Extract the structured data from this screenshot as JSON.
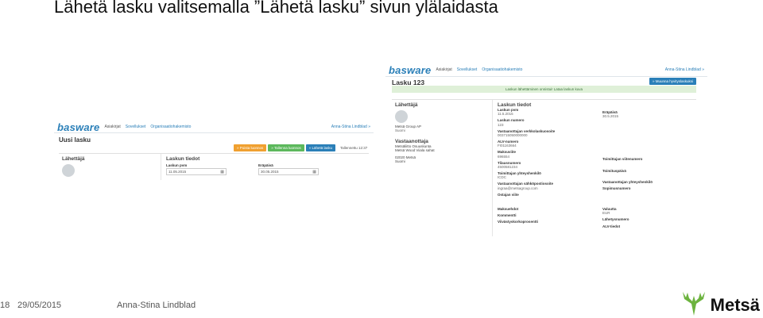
{
  "slide": {
    "title": "Lähetä lasku valitsemalla ”Lähetä lasku” sivun ylälaidasta",
    "page_number": "18",
    "date": "29/05/2015",
    "author": "Anna-Stina Lindblad",
    "logo_text": "Metsä",
    "logo_color": "#6cb33e"
  },
  "screenshot_small": {
    "logo": "basware",
    "nav": [
      "Asiakirjat",
      "Sovellukset",
      "Organisaatiohakemisto"
    ],
    "user": "Anna-Stina Lindblad »",
    "page_title": "Uusi lasku",
    "actions": [
      "» Poista luonnos",
      "» Tallenna luonnos",
      "» Lähetä lasku"
    ],
    "saved_text": "Tallennettu 12:37",
    "sender_heading": "Lähettäjä",
    "invoice_heading": "Laskun tiedot",
    "invoice_date_label": "Laskun pvm",
    "invoice_date_value": "11.05.2015",
    "due_date_label": "Eräpäivä",
    "due_date_value": "30.05.2015"
  },
  "screenshot_large": {
    "logo": "basware",
    "nav": [
      "Asiakirjat",
      "Sovellukset",
      "Organisaatiohakemisto"
    ],
    "user": "Anna-Stina Lindblad »",
    "new_button": "» Muunna hyvityslaskuksi",
    "page_title": "Lasku 123",
    "notice": "Laskun lähettäminen onnistui! Lataa laskun kuva",
    "sender_heading": "Lähettäjä",
    "sender_name": "Metsä Group AP",
    "sender_country": "Suomi",
    "recipient_heading": "Vastaanottaja",
    "recipient_lines": [
      "Metsäliitto Osuuskunta",
      "Metsä Wood Viiala sahat",
      "02020 Metsä",
      "Suomi"
    ],
    "invoice_heading": "Laskun tiedot",
    "mid_fields": [
      {
        "label": "Laskun pvm",
        "value": "11.5.2015"
      },
      {
        "label": "Laskun numero",
        "value": "123"
      },
      {
        "label": "Vastaanottajan verkkolaskuosoite",
        "value": "003715050000000"
      },
      {
        "label": "ALV-numero",
        "value": "FI01163664"
      },
      {
        "label": "Maksuviite",
        "value": "696554"
      },
      {
        "label": "Tilausnumero",
        "value": "4500581234"
      },
      {
        "label": "Toimittajan yhteyshenkilö",
        "value": "ICDC"
      },
      {
        "label": "Vastaanottajan sähköpostiosoite",
        "value": "ingraa@metsagroup.com"
      },
      {
        "label": "Ostajan viite",
        "value": ""
      },
      {
        "label": "Maksuehdot",
        "value": ""
      },
      {
        "label": "Kommentti",
        "value": ""
      },
      {
        "label": "Viivästyskorkoprosentti",
        "value": ""
      }
    ],
    "right_fields": [
      {
        "label": "Eräpäivä",
        "value": "30.5.2015"
      },
      {
        "label": "Toimittajan viitenumero",
        "value": ""
      },
      {
        "label": "Toimituspäivä",
        "value": ""
      },
      {
        "label": "Vastaanottajan yhteyshenkilö",
        "value": ""
      },
      {
        "label": "Sopimusnumero",
        "value": ""
      },
      {
        "label": "Valuutta",
        "value": "EUR"
      },
      {
        "label": "Lähetysnumero",
        "value": ""
      },
      {
        "label": "ALV-tiedot",
        "value": ""
      }
    ]
  }
}
